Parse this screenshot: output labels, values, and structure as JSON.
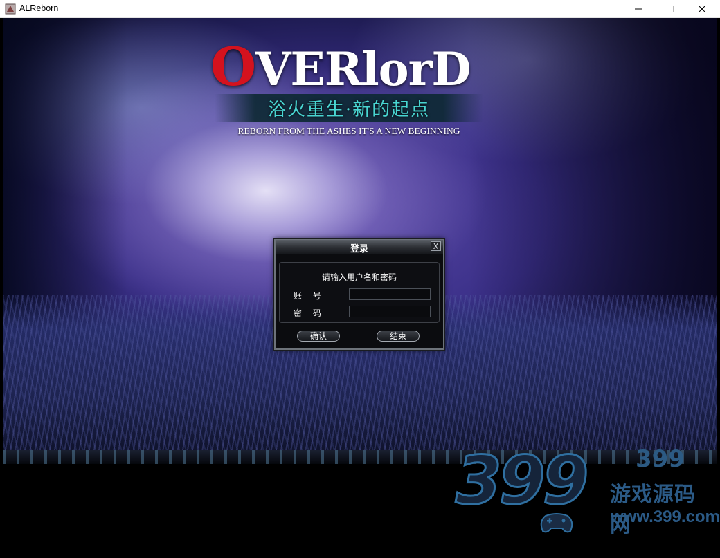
{
  "window": {
    "title": "ALReborn"
  },
  "logo": {
    "first_letter": "O",
    "rest": "VERlorD",
    "subtitle_cn": "浴火重生·新的起点",
    "subtitle_en": "REBORN FROM THE ASHES IT'S A NEW BEGINNING"
  },
  "login": {
    "title": "登录",
    "close_label": "X",
    "prompt": "请输入用户名和密码",
    "account_label": "账 号",
    "password_label": "密 码",
    "ok_label": "确认",
    "end_label": "结束"
  },
  "watermark": {
    "big": "399",
    "number": "399",
    "cn": "游戏源码网",
    "url": "www.399.com"
  },
  "colors": {
    "logo_red": "#d4121e",
    "subtitle_cyan": "#49d6d2"
  }
}
